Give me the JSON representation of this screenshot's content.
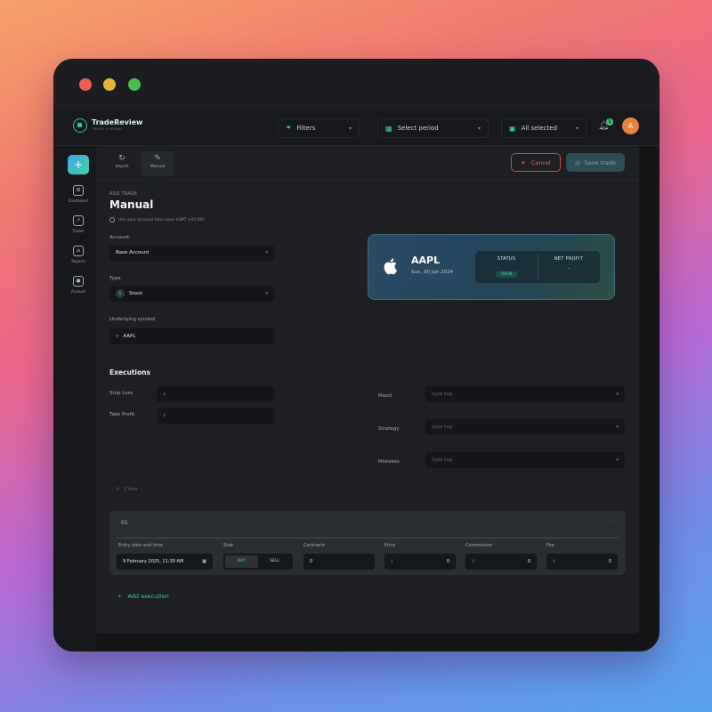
{
  "app": {
    "name": "TradeReview",
    "tagline": "TRADE JOURNAL"
  },
  "appbar": {
    "filters": "Filters",
    "period": "Select period",
    "accounts": "All selected",
    "notification_count": "1",
    "avatar_initial": "A"
  },
  "sidebar": {
    "items": [
      {
        "label": "Dashboard"
      },
      {
        "label": "Trades"
      },
      {
        "label": "Reports"
      },
      {
        "label": "Account"
      }
    ]
  },
  "toolbar": {
    "tabs": [
      {
        "label": "Import"
      },
      {
        "label": "Manual"
      }
    ],
    "cancel_label": "Cancel",
    "save_label": "Save trade"
  },
  "form": {
    "caption": "ADD TRADE",
    "title": "Manual",
    "tz_note": "Use your account time zone (GMT +01:00)",
    "account_label": "Account",
    "account_value": "Base Account",
    "type_label": "Type",
    "type_value": "Stock",
    "symbol_label": "Underlying symbol",
    "symbol_value": "AAPL",
    "executions_title": "Executions",
    "stop_loss_label": "Stop Loss",
    "take_profit_label": "Take Profit",
    "currency_symbol": "$",
    "mood_label": "Mood",
    "strategy_label": "Strategy",
    "mistakes_label": "Mistakes",
    "tag_placeholder": "type tag",
    "close_label": "Close"
  },
  "summary_card": {
    "ticker": "AAPL",
    "date": "Sun, 30 Jun 2024",
    "status_caption": "STATUS",
    "status_value": "OPEN",
    "profit_caption": "NET PROFIT",
    "profit_value": "-"
  },
  "execution": {
    "index": "01",
    "columns": {
      "datetime": "Entry date and time",
      "side": "Side",
      "contracts": "Contracts",
      "price": "Price",
      "commission": "Commission",
      "fee": "Fee"
    },
    "datetime_value": "9 February 2025, 11:30 AM",
    "side_buy": "BUY",
    "side_sell": "SELL",
    "contracts_value": "0",
    "price_value": "0",
    "commission_value": "0",
    "fee_value": "0"
  },
  "add_execution_label": "Add execution",
  "colors": {
    "accent": "#3fcf9f",
    "danger": "#ee6a6a",
    "window_bg": "#131517",
    "avatar": "#e8843a"
  }
}
